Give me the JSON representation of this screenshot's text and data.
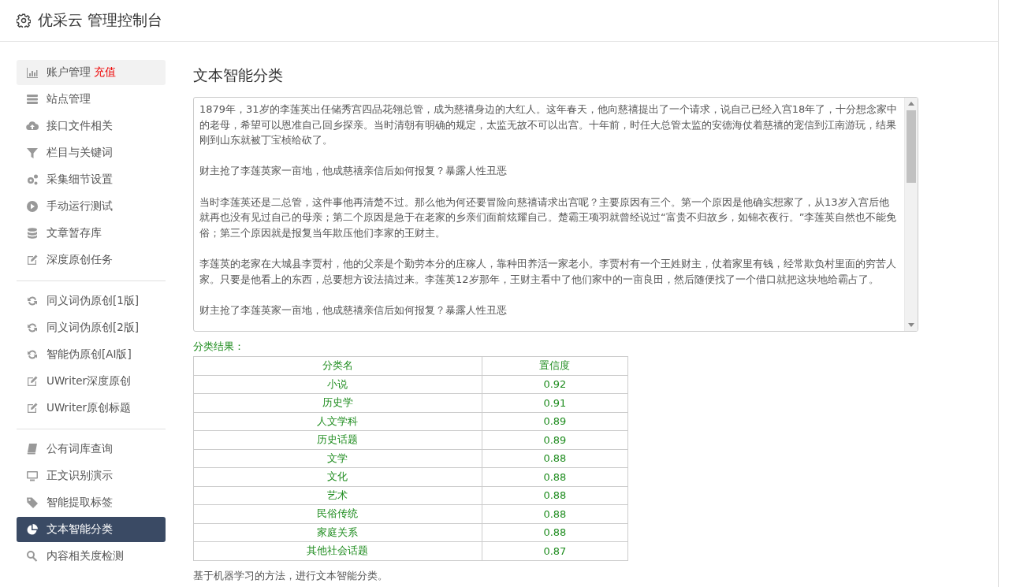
{
  "header": {
    "title": "优采云 管理控制台"
  },
  "sidebar": {
    "groups": [
      {
        "items": [
          {
            "label": "账户管理",
            "badge": "充值",
            "highlighted": true,
            "selected": false
          },
          {
            "label": "站点管理",
            "highlighted": false,
            "selected": false
          },
          {
            "label": "接口文件相关",
            "highlighted": false,
            "selected": false
          },
          {
            "label": "栏目与关键词",
            "highlighted": false,
            "selected": false
          },
          {
            "label": "采集细节设置",
            "highlighted": false,
            "selected": false
          },
          {
            "label": "手动运行测试",
            "highlighted": false,
            "selected": false
          },
          {
            "label": "文章暂存库",
            "highlighted": false,
            "selected": false
          },
          {
            "label": "深度原创任务",
            "highlighted": false,
            "selected": false
          }
        ]
      },
      {
        "items": [
          {
            "label": "同义词伪原创[1版]",
            "highlighted": false,
            "selected": false
          },
          {
            "label": "同义词伪原创[2版]",
            "highlighted": false,
            "selected": false
          },
          {
            "label": "智能伪原创[AI版]",
            "highlighted": false,
            "selected": false
          },
          {
            "label": "UWriter深度原创",
            "highlighted": false,
            "selected": false
          },
          {
            "label": "UWriter原创标题",
            "highlighted": false,
            "selected": false
          }
        ]
      },
      {
        "items": [
          {
            "label": "公有词库查询",
            "highlighted": false,
            "selected": false
          },
          {
            "label": "正文识别演示",
            "highlighted": false,
            "selected": false
          },
          {
            "label": "智能提取标签",
            "highlighted": false,
            "selected": false
          },
          {
            "label": "文本智能分类",
            "highlighted": false,
            "selected": true
          },
          {
            "label": "内容相关度检测",
            "highlighted": false,
            "selected": false
          }
        ]
      }
    ]
  },
  "content": {
    "heading": "文本智能分类",
    "text_area": {
      "paragraphs": [
        "1879年，31岁的李莲英出任储秀宫四品花翎总管，成为慈禧身边的大红人。这年春天，他向慈禧提出了一个请求，说自己已经入宫18年了，十分想念家中的老母，希望可以恩准自己回乡探亲。当时清朝有明确的规定，太监无故不可以出宫。十年前，时任大总管太监的安德海仗着慈禧的宠信到江南游玩，结果刚到山东就被丁宝桢给砍了。",
        "财主抢了李莲英家一亩地，他成慈禧亲信后如何报复？暴露人性丑恶",
        "当时李莲英还是二总管，这件事他再清楚不过。那么他为何还要冒险向慈禧请求出宫呢？主要原因有三个。第一个原因是他确实想家了，从13岁入宫后他就再也没有见过自己的母亲；第二个原因是急于在老家的乡亲们面前炫耀自己。楚霸王项羽就曾经说过“富贵不归故乡，如锦衣夜行。”李莲英自然也不能免俗；第三个原因就是报复当年欺压他们李家的王财主。",
        "李莲英的老家在大城县李贾村，他的父亲是个勤劳本分的庄稼人，靠种田养活一家老小。李贾村有一个王姓财主，仗着家里有钱，经常欺负村里面的穷苦人家。只要是他看上的东西，总要想方设法搞过来。李莲英12岁那年，王财主看中了他们家中的一亩良田，然后随便找了一个借口就把这块地给霸占了。",
        "财主抢了李莲英家一亩地，他成慈禧亲信后如何报复？暴露人性丑恶"
      ]
    },
    "result_label": "分类结果：",
    "table": {
      "columns": [
        "分类名",
        "置信度"
      ],
      "rows": [
        [
          "小说",
          "0.92"
        ],
        [
          "历史学",
          "0.91"
        ],
        [
          "人文学科",
          "0.89"
        ],
        [
          "历史话题",
          "0.89"
        ],
        [
          "文学",
          "0.88"
        ],
        [
          "文化",
          "0.88"
        ],
        [
          "艺术",
          "0.88"
        ],
        [
          "民俗传统",
          "0.88"
        ],
        [
          "家庭关系",
          "0.88"
        ],
        [
          "其他社会话题",
          "0.87"
        ]
      ]
    },
    "footnote": "基于机器学习的方法，进行文本智能分类。"
  }
}
